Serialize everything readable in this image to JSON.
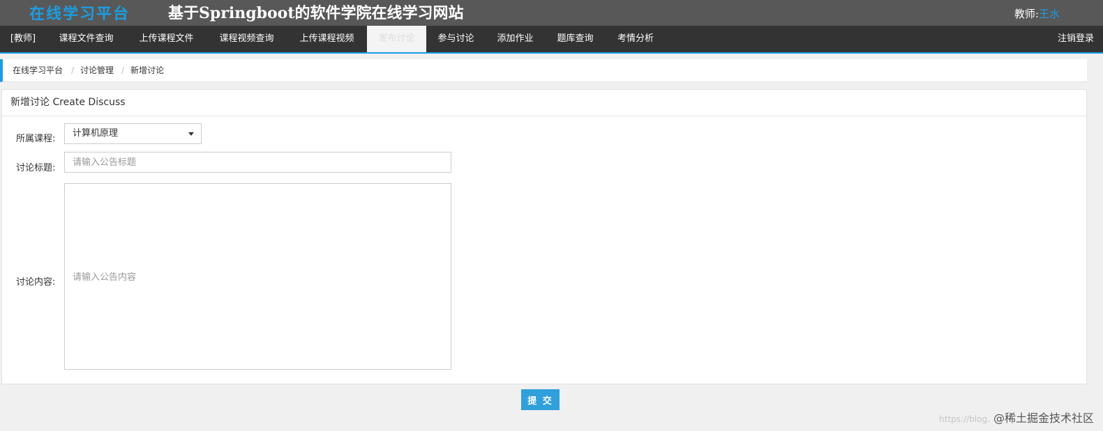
{
  "header": {
    "brand": "在线学习平台",
    "site_title": "基于Springboot的软件学院在线学习网站",
    "user_role_label": "教师:",
    "user_name": "王水"
  },
  "nav": {
    "items": [
      {
        "label": "[教师]"
      },
      {
        "label": "课程文件查询"
      },
      {
        "label": "上传课程文件"
      },
      {
        "label": "课程视频查询"
      },
      {
        "label": "上传课程视频"
      },
      {
        "label": "发布讨论",
        "active": true
      },
      {
        "label": "参与讨论"
      },
      {
        "label": "添加作业"
      },
      {
        "label": "题库查询"
      },
      {
        "label": "考情分析"
      }
    ],
    "logout_label": "注销登录"
  },
  "breadcrumb": {
    "items": [
      "在线学习平台",
      "讨论管理",
      "新增讨论"
    ],
    "separator": "/"
  },
  "form": {
    "title": "新增讨论 Create Discuss",
    "course_label": "所属课程:",
    "course_value": "计算机原理",
    "title_label": "讨论标题:",
    "title_placeholder": "请输入公告标题",
    "content_label": "讨论内容:",
    "content_placeholder": "请输入公告内容",
    "submit_label": "提 交"
  },
  "watermark": {
    "url_text": "https://blog.",
    "text": "@稀土掘金技术社区"
  },
  "colors": {
    "accent": "#1c9de0",
    "topbar": "#585858",
    "navbar": "#333333",
    "submit": "#30a0db"
  }
}
